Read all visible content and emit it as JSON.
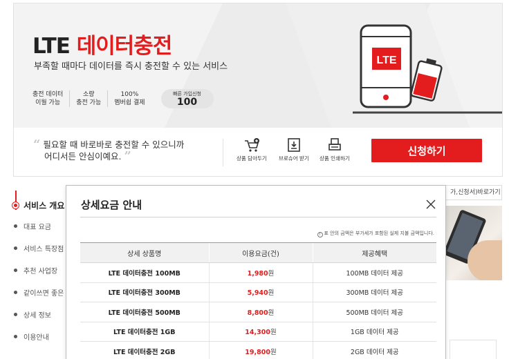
{
  "product": {
    "title_prefix": "LTE",
    "title_highlight": "데이터충전",
    "subtitle": "부족할 때마다 데이터를 즉시 충전할 수 있는 서비스",
    "features": [
      {
        "line1": "충전 데이터",
        "line2": "이월 가능"
      },
      {
        "line1": "소량",
        "line2": "충전 가능"
      },
      {
        "line1": "100%",
        "line2": "멤버쉽 결제"
      }
    ],
    "quick_signup": {
      "label": "빠른 가입신청",
      "number": "100"
    },
    "illustration_label": "LTE"
  },
  "action_bar": {
    "quote_open": "“",
    "quote_line1": "필요할 때 바로바로 충전할 수 있으니까",
    "quote_line2": "어디서든 안심이예요.",
    "quote_close": "”",
    "tools": [
      {
        "icon": "cart-add-icon",
        "label": "상품 담아두기"
      },
      {
        "icon": "download-icon",
        "label": "브로슈어 받기"
      },
      {
        "icon": "printer-icon",
        "label": "상품 인쇄하기"
      }
    ],
    "apply_label": "신청하기"
  },
  "side_nav": {
    "items": [
      {
        "label": "서비스 개요",
        "active": true
      },
      {
        "label": "대표 요금",
        "active": false
      },
      {
        "label": "서비스 특장점",
        "active": false
      },
      {
        "label": "추천 사업장",
        "active": false
      },
      {
        "label": "같이쓰면 좋은",
        "active": false
      },
      {
        "label": "상세 정보",
        "active": false
      },
      {
        "label": "이용안내",
        "active": false
      }
    ]
  },
  "background": {
    "link_text": "가,신청서)바로가기"
  },
  "modal": {
    "title": "상세요금 안내",
    "close_icon": "close-icon",
    "notice": "표 안의 금액은 부가세가 포함된 실제 지불 금액입니다.",
    "notice_icon": "info-icon",
    "columns": [
      "상세 상품명",
      "이용요금(건)",
      "제공혜택"
    ],
    "rows": [
      {
        "name": "LTE 데이터충전 100MB",
        "price": "1,980",
        "unit": "원",
        "benefit": "100MB 데이터 제공"
      },
      {
        "name": "LTE 데이터충전 300MB",
        "price": "5,940",
        "unit": "원",
        "benefit": "300MB 데이터 제공"
      },
      {
        "name": "LTE 데이터충전 500MB",
        "price": "8,800",
        "unit": "원",
        "benefit": "500MB 데이터 제공"
      },
      {
        "name": "LTE 데이터충전 1GB",
        "price": "14,300",
        "unit": "원",
        "benefit": "1GB 데이터 제공"
      },
      {
        "name": "LTE 데이터충전 2GB",
        "price": "19,800",
        "unit": "원",
        "benefit": "2GB 데이터 제공"
      }
    ]
  },
  "colors": {
    "accent": "#e31d1d",
    "text": "#222222",
    "header_bg": "#f1f1f1"
  }
}
